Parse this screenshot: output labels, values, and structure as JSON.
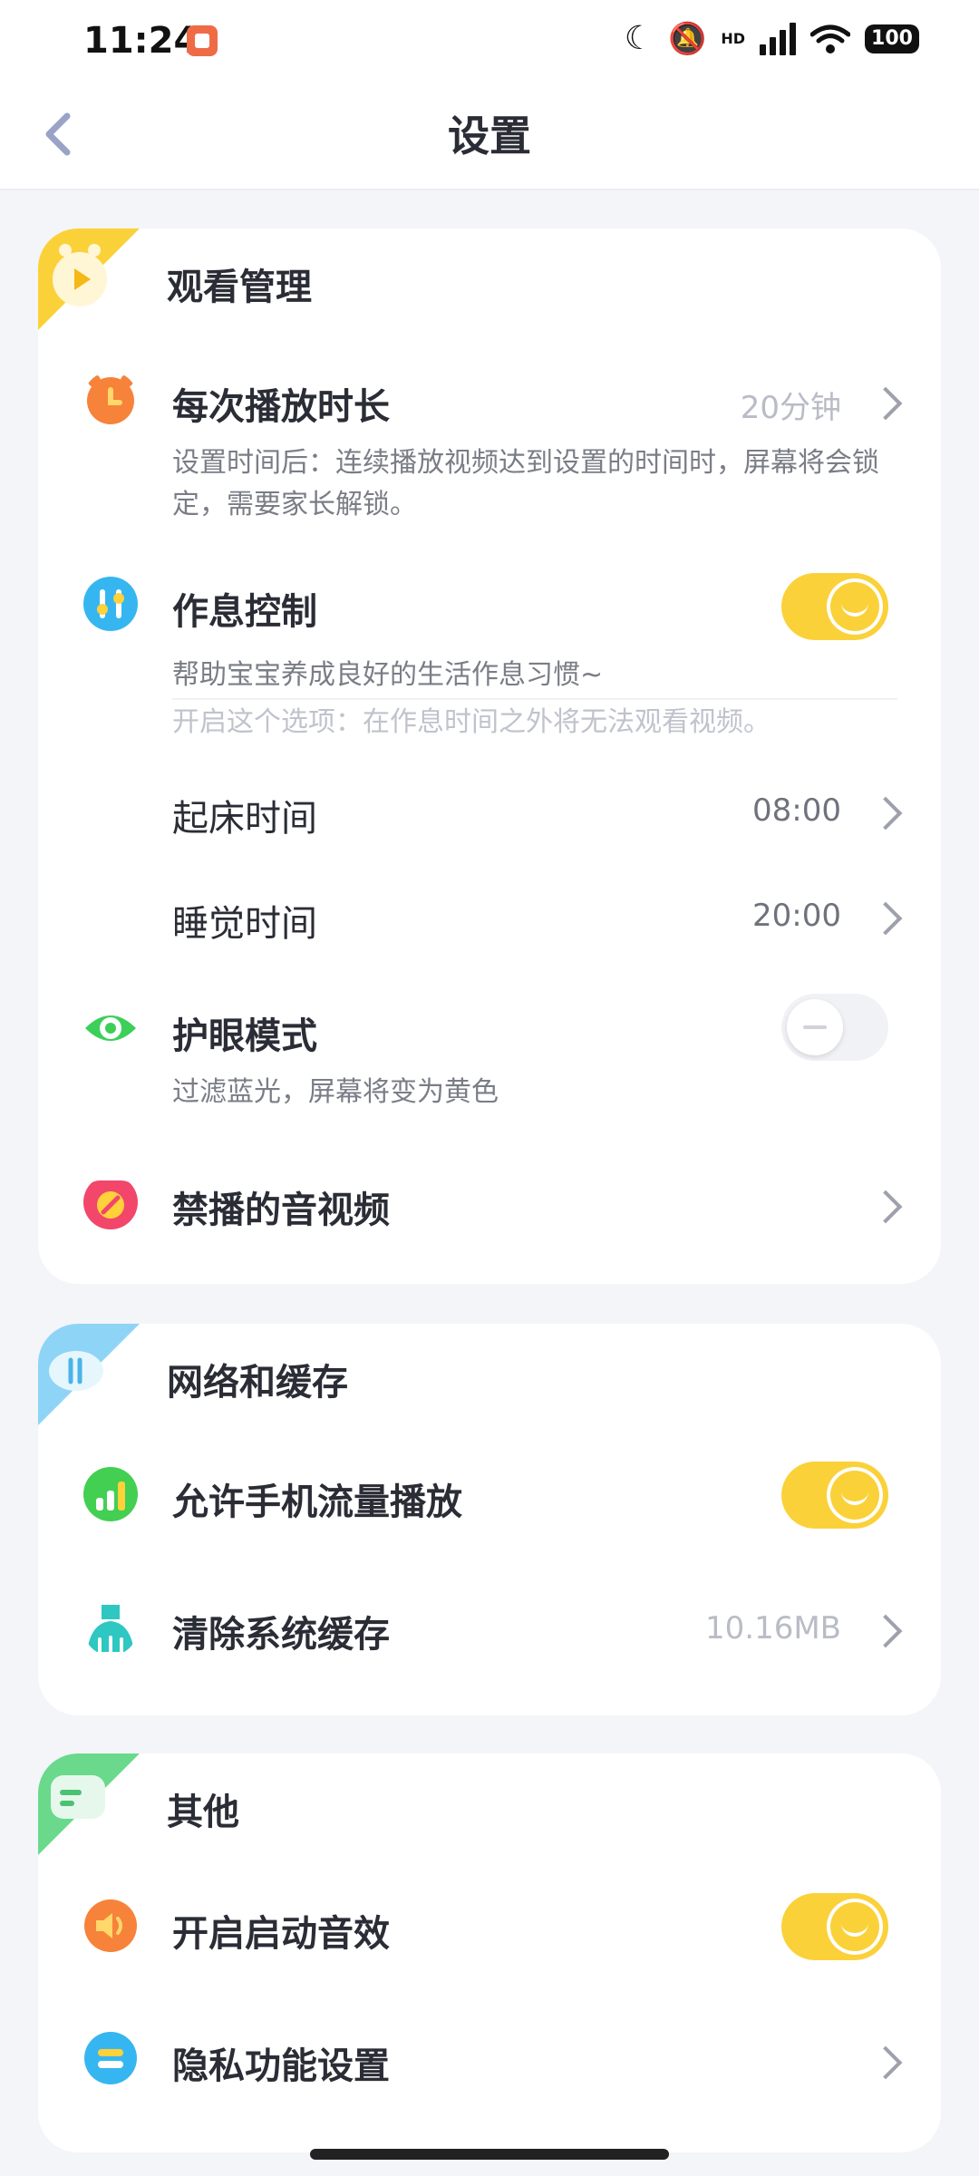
{
  "status_bar": {
    "time": "11:24",
    "network_label": "HD",
    "battery": "100"
  },
  "header": {
    "title": "设置"
  },
  "sections": {
    "watch": {
      "title": "观看管理",
      "duration": {
        "label": "每次播放时长",
        "value": "20分钟",
        "description": "设置时间后：连续播放视频达到设置的时间时，屏幕将会锁定，需要家长解锁。"
      },
      "schedule": {
        "label": "作息控制",
        "enabled": true,
        "description": "帮助宝宝养成良好的生活作息习惯~",
        "note": "开启这个选项：在作息时间之外将无法观看视频。"
      },
      "wake": {
        "label": "起床时间",
        "value": "08:00"
      },
      "sleep": {
        "label": "睡觉时间",
        "value": "20:00"
      },
      "eye_care": {
        "label": "护眼模式",
        "enabled": false,
        "description": "过滤蓝光，屏幕将变为黄色"
      },
      "blocked": {
        "label": "禁播的音视频"
      }
    },
    "network": {
      "title": "网络和缓存",
      "mobile_data": {
        "label": "允许手机流量播放",
        "enabled": true
      },
      "clear_cache": {
        "label": "清除系统缓存",
        "value": "10.16MB"
      }
    },
    "other": {
      "title": "其他",
      "startup_sound": {
        "label": "开启启动音效",
        "enabled": true
      },
      "privacy": {
        "label": "隐私功能设置"
      }
    }
  },
  "colors": {
    "accent": "#fbd13a",
    "background": "#f4f5f9",
    "card": "#ffffff"
  }
}
